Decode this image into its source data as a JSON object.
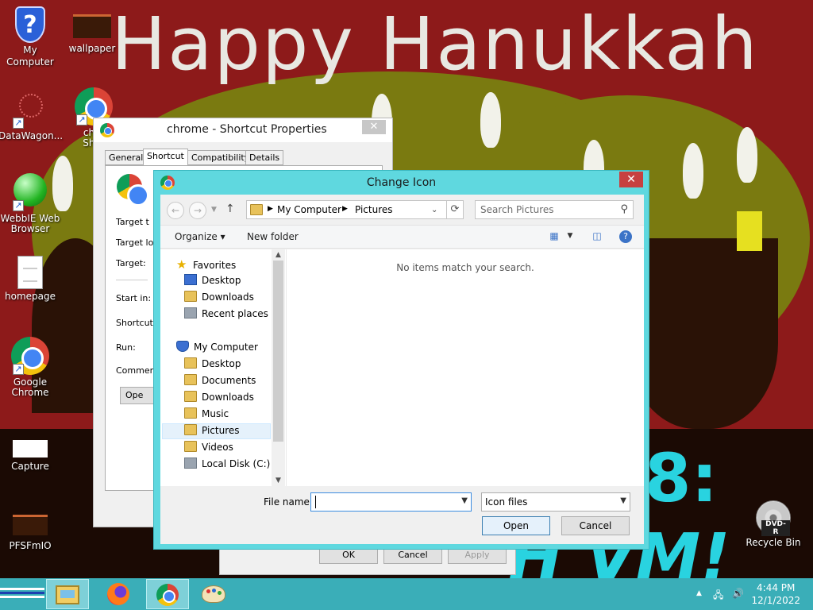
{
  "wallpaper": {
    "headline": "Happy Hanukkah",
    "line2": "8:",
    "line3": "H VM!"
  },
  "desktop_icons": [
    {
      "label": "My Computer",
      "icon": "shield-icon"
    },
    {
      "label": "wallpaper",
      "icon": "image-icon"
    },
    {
      "label": "DataWagon...",
      "icon": "network-icon"
    },
    {
      "label": "chro",
      "label2": "Shor",
      "icon": "chrome-icon"
    },
    {
      "label": "WebbIE Web",
      "label2": "Browser",
      "icon": "green-ball-icon"
    },
    {
      "label": "homepage",
      "icon": "document-icon"
    },
    {
      "label": "Google",
      "label2": "Chrome",
      "icon": "chrome-icon"
    },
    {
      "label": "Capture",
      "icon": "image-icon"
    },
    {
      "label": "PFSFmIO",
      "icon": "image-icon"
    },
    {
      "label": "Recycle Bin",
      "icon": "dvd-icon",
      "badge": "DVD-R"
    }
  ],
  "properties_dialog": {
    "title": "chrome - Shortcut Properties",
    "tabs": [
      "General",
      "Shortcut",
      "Compatibility",
      "Details"
    ],
    "active_tab": "Shortcut",
    "labels": [
      "Target t",
      "Target lo",
      "Target:",
      "Start in:",
      "Shortcut",
      "Run:",
      "Commen"
    ],
    "open_button": "Ope",
    "close": "✕"
  },
  "underlying_buttons": {
    "ok": "OK",
    "cancel": "Cancel",
    "apply": "Apply"
  },
  "change_icon": {
    "title": "Change Icon",
    "close": "✕",
    "breadcrumb": [
      "My Computer",
      "Pictures"
    ],
    "search_placeholder": "Search Pictures",
    "organize": "Organize",
    "new_folder": "New folder",
    "empty_message": "No items match your search.",
    "tree": {
      "favorites": "Favorites",
      "favorites_items": [
        "Desktop",
        "Downloads",
        "Recent places"
      ],
      "computer": "My Computer",
      "computer_items": [
        "Desktop",
        "Documents",
        "Downloads",
        "Music",
        "Pictures",
        "Videos",
        "Local Disk (C:)"
      ],
      "selected": "Pictures"
    },
    "file_name_label": "File name:",
    "file_name_value": "",
    "file_type": "Icon files",
    "open_button": "Open",
    "cancel_button": "Cancel"
  },
  "taskbar": {
    "clock_time": "4:44 PM",
    "clock_date": "12/1/2022"
  },
  "colors": {
    "wallpaper_red": "#8d1a1a",
    "wallpaper_olive": "#7a7a10",
    "accent_cyan": "#5fd8df",
    "taskbar": "#3aaeb8",
    "close_red": "#c74040"
  }
}
